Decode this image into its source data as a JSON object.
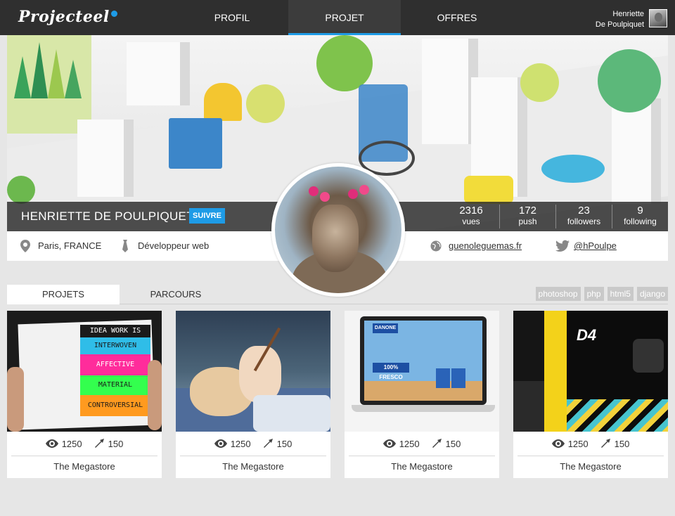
{
  "header": {
    "logo": "Projecteel",
    "nav": [
      {
        "label": "PROFIL"
      },
      {
        "label": "PROJET"
      },
      {
        "label": "OFFRES"
      }
    ],
    "user": {
      "first": "Henriette",
      "last": "De Poulpiquet"
    }
  },
  "profile": {
    "name": "HENRIETTE DE POULPIQUET",
    "follow_label": "SUIVRE",
    "stats": [
      {
        "value": "2316",
        "label": "vues"
      },
      {
        "value": "172",
        "label": "push"
      },
      {
        "value": "23",
        "label": "followers"
      },
      {
        "value": "9",
        "label": "following"
      }
    ],
    "location": "Paris, FRANCE",
    "job": "Développeur web",
    "website": "guenoleguemas.fr",
    "twitter": "@hPoulpe"
  },
  "tabs": [
    {
      "label": "PROJETS"
    },
    {
      "label": "PARCOURS"
    }
  ],
  "tags": [
    "photoshop",
    "php",
    "html5",
    "django"
  ],
  "projects": [
    {
      "views": "1250",
      "pushes": "150",
      "title": "The Megastore",
      "thumb_lines": [
        "IDEA WORK IS",
        "INTERWOVEN",
        "AFFECTIVE",
        "MATERIAL",
        "CONTROVERSIAL"
      ]
    },
    {
      "views": "1250",
      "pushes": "150",
      "title": "The Megastore"
    },
    {
      "views": "1250",
      "pushes": "150",
      "title": "The Megastore",
      "thumb_lines": [
        "DANONE",
        "100% FRESCO"
      ]
    },
    {
      "views": "1250",
      "pushes": "150",
      "title": "The Megastore",
      "thumb_lines": [
        "D4"
      ]
    }
  ],
  "colors": {
    "accent": "#1e9be6",
    "topbar": "#2f2f2f"
  }
}
